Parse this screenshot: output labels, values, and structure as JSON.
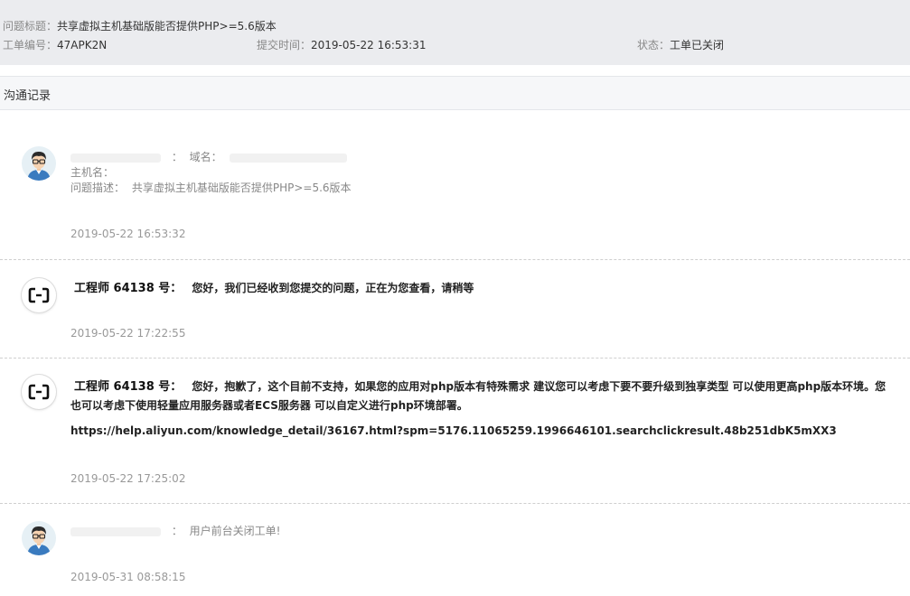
{
  "ticket": {
    "title_label": "问题标题：",
    "title_value": "共享虚拟主机基础版能否提供PHP>=5.6版本",
    "id_label": "工单编号：",
    "id_value": "47APK2N",
    "submit_label": "提交时间：",
    "submit_value": "2019-05-22 16:53:31",
    "status_label": "状态：",
    "status_value": "工单已关闭"
  },
  "section": {
    "title": "沟通记录"
  },
  "messages": [
    {
      "colon": "：",
      "domain_label": "域名：",
      "host_label": "主机名：",
      "desc_label": "问题描述：",
      "desc_value": "共享虚拟主机基础版能否提供PHP>=5.6版本",
      "time": "2019-05-22 16:53:32"
    },
    {
      "author": "工程师 64138 号：",
      "text": "您好，我们已经收到您提交的问题，正在为您查看，请稍等",
      "time": "2019-05-22 17:22:55"
    },
    {
      "author": "工程师 64138 号：",
      "text": "您好，抱歉了，这个目前不支持，如果您的应用对php版本有特殊需求  建议您可以考虑下要不要升级到独享类型  可以使用更高php版本环境。您也可以考虑下使用轻量应用服务器或者ECS服务器 可以自定义进行php环境部署。",
      "link": "https://help.aliyun.com/knowledge_detail/36167.html?spm=5176.11065259.1996646101.searchclickresult.48b251dbK5mXX3",
      "time": "2019-05-22 17:25:02"
    },
    {
      "colon": "：",
      "text": "用户前台关闭工单!",
      "time": "2019-05-31 08:58:15"
    }
  ],
  "icons": {
    "user_avatar": "user-avatar-icon",
    "engineer_avatar": "aliyun-logo-icon"
  },
  "colors": {
    "header_bg": "#ebecef",
    "section_bg": "#f6f7f9",
    "divider": "#cfcfcf"
  }
}
